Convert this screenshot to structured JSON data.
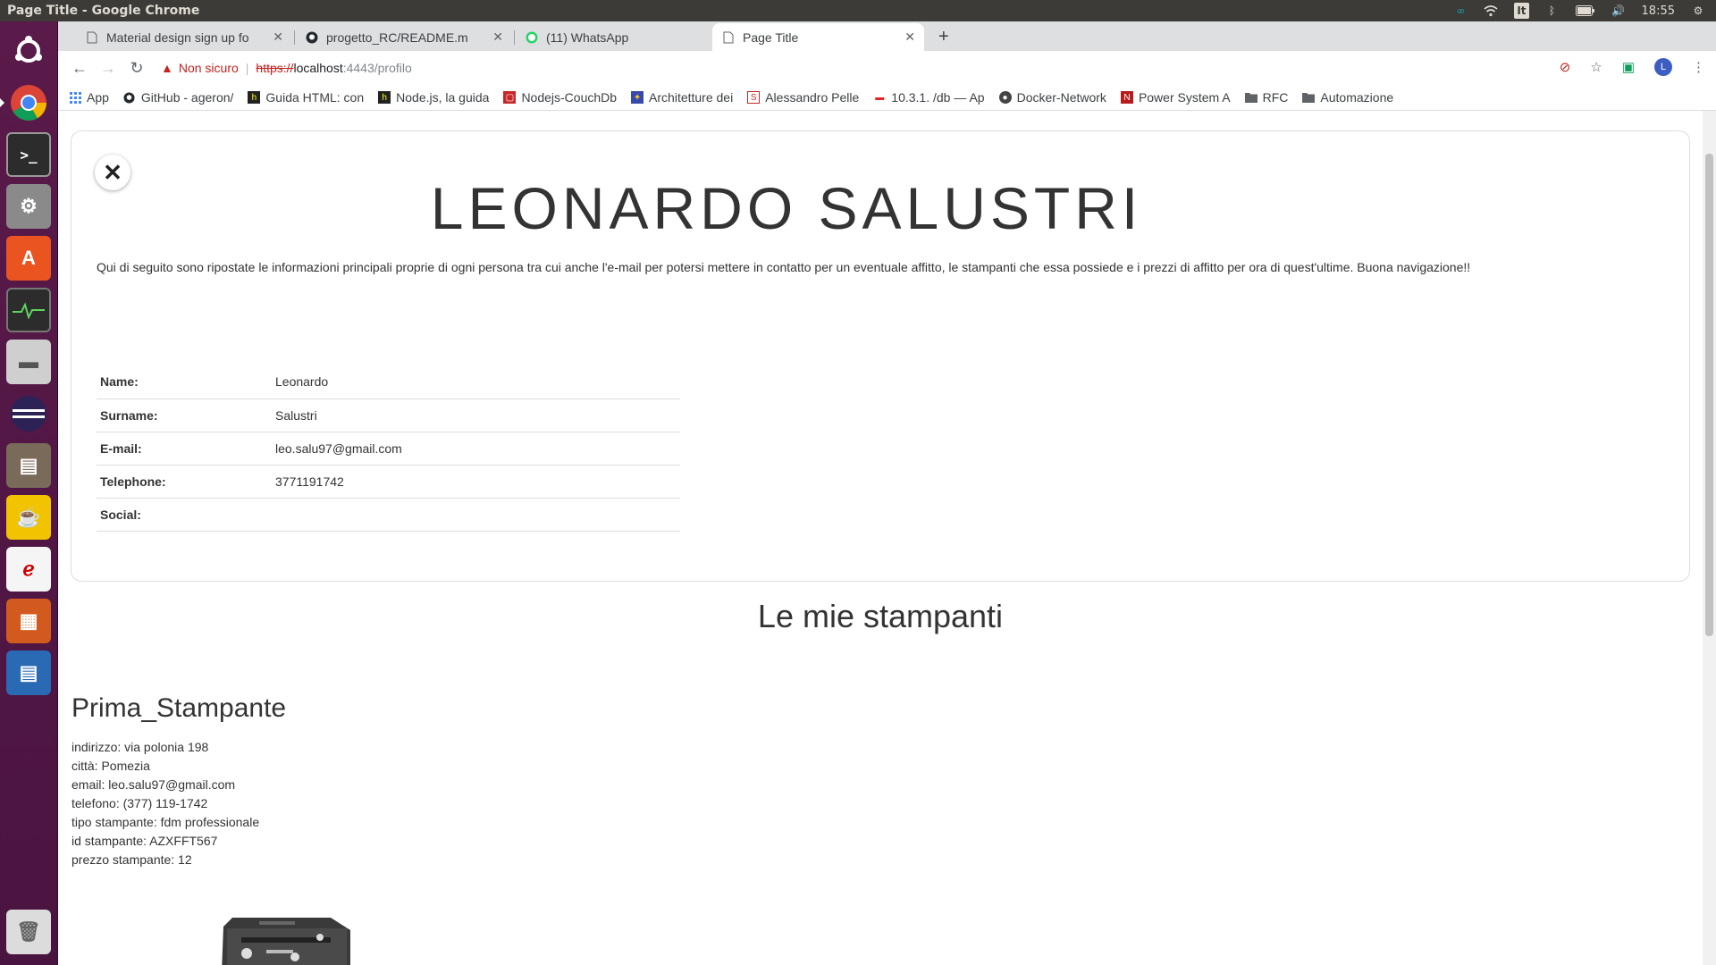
{
  "os": {
    "window_title": "Page Title - Google Chrome",
    "clock": "18:55",
    "keyboard_layout": "It"
  },
  "tabs": [
    {
      "title": "Material design sign up fo",
      "icon": "page-icon",
      "active": false
    },
    {
      "title": "progetto_RC/README.m",
      "icon": "github-icon",
      "active": false
    },
    {
      "title": "(11) WhatsApp",
      "icon": "whatsapp-icon",
      "active": false
    },
    {
      "title": "Page Title",
      "icon": "page-icon",
      "active": true
    }
  ],
  "address_bar": {
    "security_label": "Non sicuro",
    "scheme": "https://",
    "host": "localhost",
    "path": ":4443/profilo",
    "avatar_letter": "L"
  },
  "bookmarks": [
    {
      "label": "App"
    },
    {
      "label": "GitHub - ageron/"
    },
    {
      "label": "Guida HTML: con"
    },
    {
      "label": "Node.js, la guida"
    },
    {
      "label": "Nodejs-CouchDb"
    },
    {
      "label": "Architetture dei"
    },
    {
      "label": "Alessandro Pelle"
    },
    {
      "label": "10.3.1. /db — Ap"
    },
    {
      "label": "Docker-Network"
    },
    {
      "label": "Power System A"
    },
    {
      "label": "RFC"
    },
    {
      "label": "Automazione"
    }
  ],
  "profile": {
    "title": "LEONARDO SALUSTRI",
    "description": "Qui di seguito sono ripostate le informazioni principali proprie di ogni persona tra cui anche l'e-mail per potersi mettere in contatto per un eventuale affitto, le stampanti che essa possiede e i prezzi di affitto per ora di quest'ultime. Buona navigazione!!",
    "fields": [
      {
        "label": "Name:",
        "value": "Leonardo"
      },
      {
        "label": "Surname:",
        "value": "Salustri"
      },
      {
        "label": "E-mail:",
        "value": "leo.salu97@gmail.com"
      },
      {
        "label": "Telephone:",
        "value": "3771191742"
      },
      {
        "label": "Social:",
        "value": ""
      }
    ]
  },
  "printers_section": {
    "title": "Le mie stampanti",
    "printer": {
      "name": "Prima_Stampante",
      "details": [
        "indirizzo: via polonia 198",
        "città: Pomezia",
        "email: leo.salu97@gmail.com",
        "telefono: (377) 119-1742",
        "tipo stampante: fdm professionale",
        "id stampante: AZXFFT567",
        "prezzo stampante: 12"
      ]
    }
  }
}
